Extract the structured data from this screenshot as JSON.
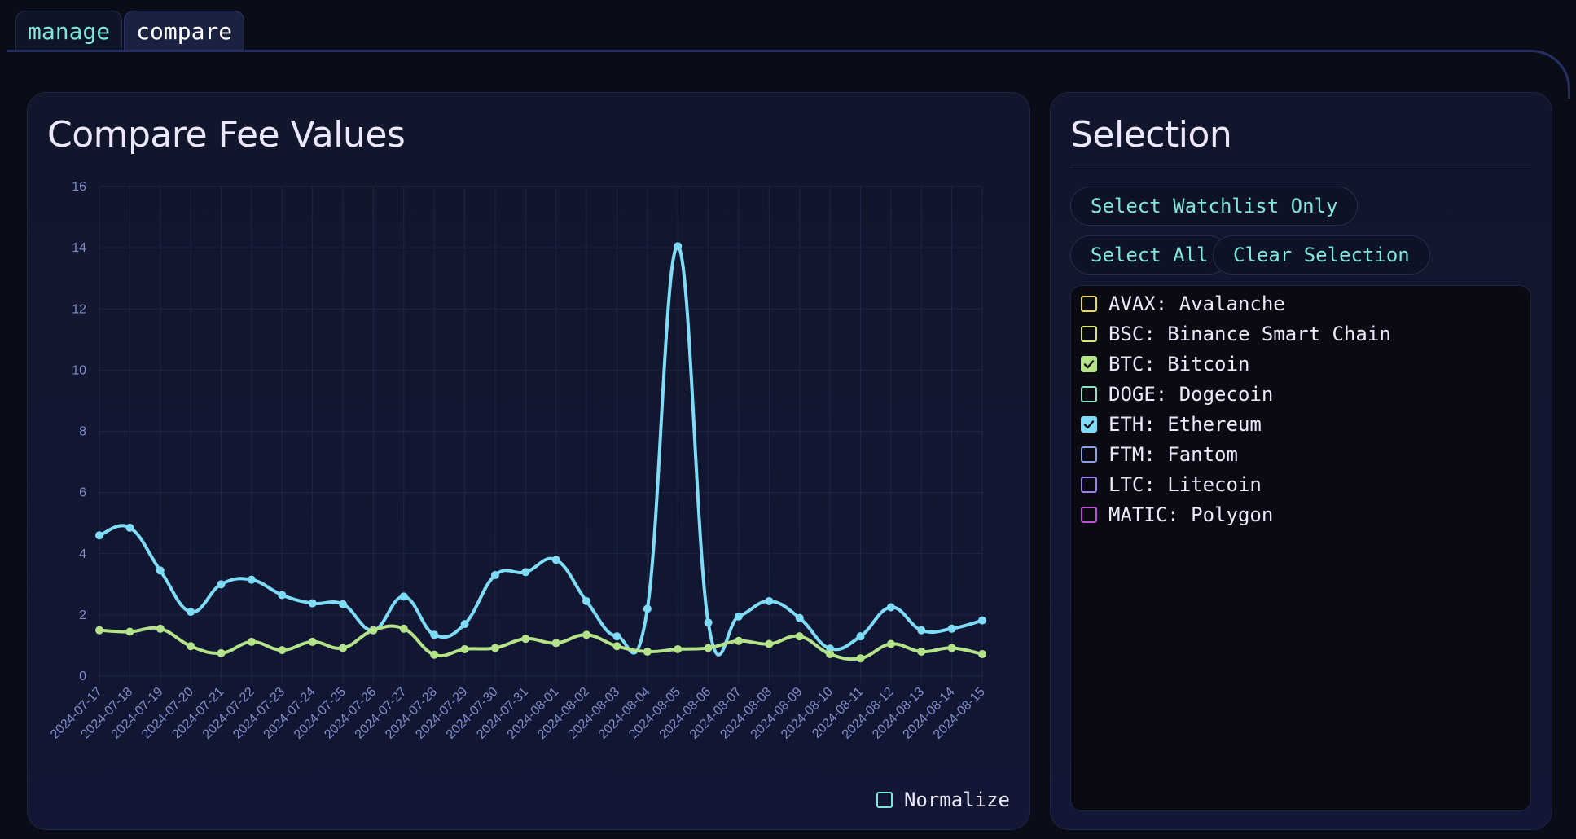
{
  "tabs": [
    {
      "label": "manage",
      "active": false
    },
    {
      "label": "compare",
      "active": true
    }
  ],
  "chart_panel": {
    "title": "Compare Fee Values",
    "normalize_label": "Normalize",
    "normalize_checked": false
  },
  "selection": {
    "title": "Selection",
    "watchlist_button": "Select Watchlist Only",
    "select_all_button": "Select All",
    "clear_button": "Clear Selection",
    "coins": [
      {
        "label": "AVAX: Avalanche",
        "color": "#e8dc4a",
        "checked": false
      },
      {
        "label": "BSC: Binance Smart Chain",
        "color": "#d6e86c",
        "checked": false
      },
      {
        "label": "BTC: Bitcoin",
        "color": "#b4e38a",
        "checked": true
      },
      {
        "label": "DOGE: Dogecoin",
        "color": "#8fe0c4",
        "checked": false
      },
      {
        "label": "ETH: Ethereum",
        "color": "#7fdcf6",
        "checked": true
      },
      {
        "label": "FTM: Fantom",
        "color": "#8aa2ea",
        "checked": false
      },
      {
        "label": "LTC: Litecoin",
        "color": "#9d7ef0",
        "checked": false
      },
      {
        "label": "MATIC: Polygon",
        "color": "#c04ed8",
        "checked": false
      }
    ]
  },
  "chart_data": {
    "type": "line",
    "title": "",
    "xlabel": "",
    "ylabel": "",
    "ylim": [
      0,
      16
    ],
    "yticks": [
      0,
      2,
      4,
      6,
      8,
      10,
      12,
      14,
      16
    ],
    "grid": true,
    "categories": [
      "2024-07-17",
      "2024-07-18",
      "2024-07-19",
      "2024-07-20",
      "2024-07-21",
      "2024-07-22",
      "2024-07-23",
      "2024-07-24",
      "2024-07-25",
      "2024-07-26",
      "2024-07-27",
      "2024-07-28",
      "2024-07-29",
      "2024-07-30",
      "2024-07-31",
      "2024-08-01",
      "2024-08-02",
      "2024-08-03",
      "2024-08-04",
      "2024-08-05",
      "2024-08-06",
      "2024-08-07",
      "2024-08-08",
      "2024-08-09",
      "2024-08-10",
      "2024-08-11",
      "2024-08-12",
      "2024-08-13",
      "2024-08-14",
      "2024-08-15"
    ],
    "series": [
      {
        "color": "#7fdcf6",
        "values": [
          4.6,
          4.85,
          3.45,
          2.1,
          3.0,
          3.15,
          2.65,
          2.38,
          2.35,
          1.5,
          2.6,
          1.35,
          1.7,
          3.3,
          3.4,
          3.8,
          2.45,
          1.3,
          2.2,
          14.05,
          1.75,
          1.95,
          2.45,
          1.9,
          0.9,
          1.3,
          2.25,
          1.5,
          1.55,
          1.82
        ]
      },
      {
        "color": "#b4e38a",
        "values": [
          1.5,
          1.45,
          1.55,
          0.98,
          0.75,
          1.12,
          0.85,
          1.12,
          0.92,
          1.5,
          1.55,
          0.7,
          0.88,
          0.92,
          1.22,
          1.08,
          1.35,
          0.98,
          0.8,
          0.88,
          0.92,
          1.15,
          1.05,
          1.3,
          0.72,
          0.58,
          1.05,
          0.8,
          0.92,
          0.72
        ]
      }
    ]
  }
}
